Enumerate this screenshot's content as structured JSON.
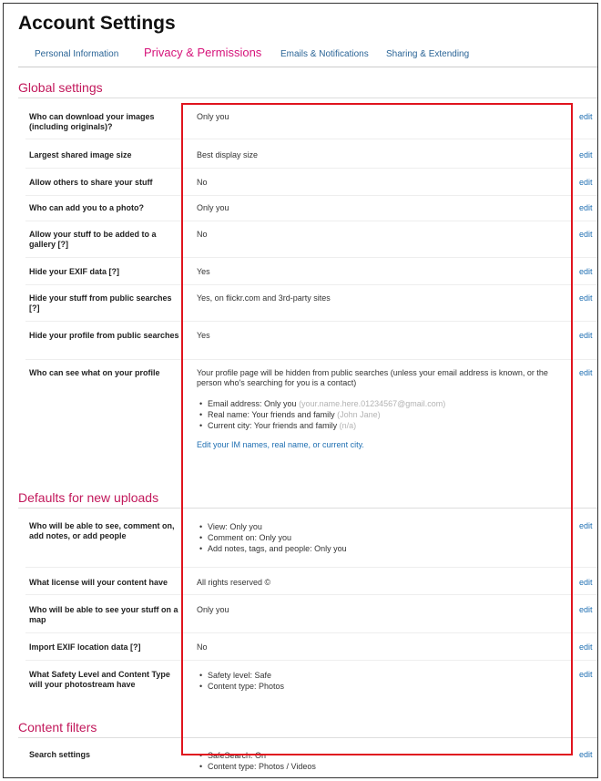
{
  "page": {
    "title": "Account Settings"
  },
  "tabs": [
    {
      "label": "Personal Information",
      "active": false
    },
    {
      "label": "Privacy & Permissions",
      "active": true
    },
    {
      "label": "Emails & Notifications",
      "active": false
    },
    {
      "label": "Sharing & Extending",
      "active": false
    }
  ],
  "sections": {
    "global": {
      "title": "Global settings"
    },
    "defaults": {
      "title": "Defaults for new uploads"
    },
    "filters": {
      "title": "Content filters"
    }
  },
  "edit_label": "edit",
  "rows": {
    "download": {
      "label": "Who can download your images (including originals)?",
      "value": "Only you"
    },
    "shared_size": {
      "label": "Largest shared image size",
      "value": "Best display size"
    },
    "allow_share": {
      "label": "Allow others to share your stuff",
      "value": "No"
    },
    "add_to_photo": {
      "label": "Who can add you to a photo?",
      "value": "Only you"
    },
    "gallery": {
      "label": "Allow your stuff to be added to a gallery [?]",
      "value": "No"
    },
    "hide_exif": {
      "label": "Hide your EXIF data [?]",
      "value": "Yes"
    },
    "hide_search": {
      "label": "Hide your stuff from public searches [?]",
      "value": "Yes, on flickr.com and 3rd-party sites"
    },
    "hide_profile": {
      "label": "Hide your profile from public searches",
      "value": "Yes"
    },
    "profile_visibility": {
      "label": "Who can see what on your profile",
      "value": "Your profile page will be hidden from public searches (unless your email address is known, or the person who's searching for you is a contact)",
      "items": [
        {
          "text": "Email address: Only you",
          "hint": "(your.name.here.01234567@gmail.com)"
        },
        {
          "text": "Real name: Your friends and family",
          "hint": "(John Jane)"
        },
        {
          "text": "Current city: Your friends and family",
          "hint": "(n/a)"
        }
      ],
      "link": "Edit your IM names, real name, or current city."
    },
    "view_comment": {
      "label": "Who will be able to see, comment on, add notes, or add people",
      "items": [
        "View: Only you",
        "Comment on: Only you",
        "Add notes, tags, and people: Only you"
      ]
    },
    "license": {
      "label": "What license will your content have",
      "value": "All rights reserved ©"
    },
    "map": {
      "label": "Who will be able to see your stuff on a map",
      "value": "Only you"
    },
    "import_exif": {
      "label": "Import EXIF location data [?]",
      "value": "No"
    },
    "safety": {
      "label": "What Safety Level and Content Type will your photostream have",
      "items": [
        "Safety level: Safe",
        "Content type: Photos"
      ]
    },
    "search_settings": {
      "label": "Search settings",
      "items": [
        "SafeSearch: On",
        "Content type: Photos / Videos"
      ]
    }
  }
}
